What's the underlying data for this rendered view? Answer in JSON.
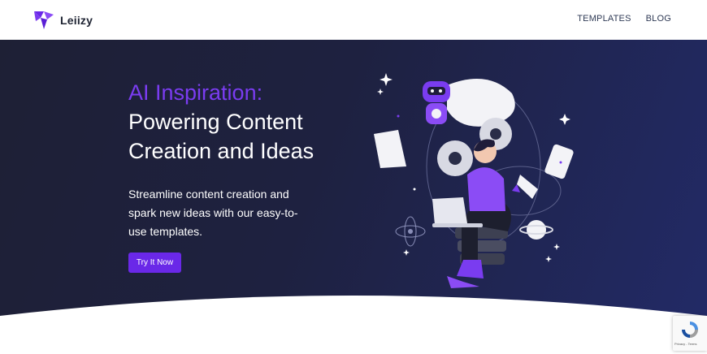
{
  "brand": {
    "name": "Leiizy",
    "color": "#6a28e8"
  },
  "nav": {
    "items": [
      {
        "label": "TEMPLATES"
      },
      {
        "label": "BLOG"
      }
    ]
  },
  "hero": {
    "highlight": "AI Inspiration:",
    "title_line1": "Powering Content",
    "title_line2": "Creation and Ideas",
    "description": "Streamline content creation and spark new ideas with our easy-to-use templates.",
    "cta_label": "Try It Now",
    "accent": "#7a3cf0",
    "background": "#1e2035"
  },
  "recaptcha": {
    "text": "Privacy - Terms",
    "icon": "recaptcha-icon"
  }
}
